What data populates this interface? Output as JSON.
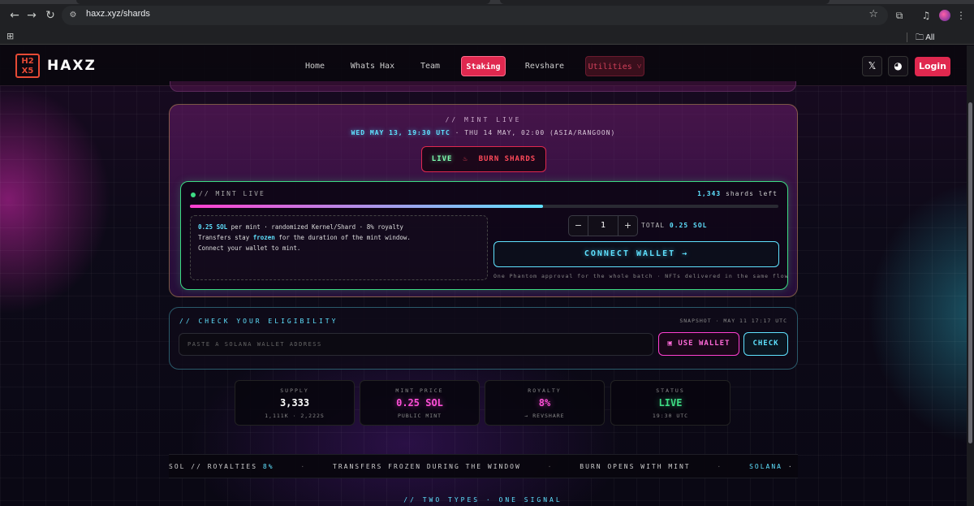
{
  "browser": {
    "url": "haxz.xyz/shards",
    "bookmarks_label": "All Bookmarks"
  },
  "header": {
    "logo_text": "HAXZ",
    "nav": [
      "Home",
      "Whats Hax",
      "Team",
      "Staking",
      "Revshare",
      "Utilities"
    ],
    "active_nav": "Staking",
    "login_label": "Login"
  },
  "mint": {
    "kicker": "// MINT LIVE",
    "start_time": "WED MAY 13, 19:30 UTC",
    "separator": "·",
    "end_time": "THU 14 MAY, 02:00 (ASIA/RANGOON)",
    "live_label": "LIVE",
    "burn_label": "BURN SHARDS",
    "status_label": "// MINT LIVE",
    "shards_left_count": "1,343",
    "shards_left_suffix": "shards left",
    "progress_fraction": 0.6,
    "info": {
      "price": "0.25 SOL",
      "line1_rest": "per mint · randomized Kernel/Shard · 8% royalty",
      "line2_pre": "Transfers stay",
      "line2_hl": "frozen",
      "line2_post": "for the duration of the mint window.",
      "line3": "Connect your wallet to mint."
    },
    "quantity": "1",
    "total_label": "TOTAL",
    "total_value": "0.25 SOL",
    "connect_label": "CONNECT WALLET →",
    "phantom_note": "One Phantom approval for the whole batch · NFTs delivered in the same flow"
  },
  "eligibility": {
    "title": "// CHECK YOUR ELIGIBILITY",
    "snapshot": "SNAPSHOT · MAY 11 17:17 UTC",
    "placeholder": "PASTE A SOLANA WALLET ADDRESS",
    "use_wallet_label": "USE WALLET",
    "check_label": "CHECK"
  },
  "stats": [
    {
      "label": "SUPPLY",
      "value": "3,333",
      "sub": "1,111K · 2,222S",
      "color": "#ffffff"
    },
    {
      "label": "MINT PRICE",
      "value": "0.25 SOL",
      "sub": "PUBLIC MINT",
      "color": "#ff4fd8"
    },
    {
      "label": "ROYALTY",
      "value": "8%",
      "sub": "→ REVSHARE",
      "color": "#ff4fd8"
    },
    {
      "label": "STATUS",
      "value": "LIVE",
      "sub": "19:30 UTC",
      "color": "#3ddc84"
    }
  ],
  "ticker": {
    "seg1_pre": "SOL // ROYALTIES",
    "seg1_hl": "8%",
    "seg2": "TRANSFERS FROZEN DURING THE WINDOW",
    "seg3": "BURN OPENS WITH MINT",
    "seg4_hl": "SOLANA",
    "seg4_post": "· NON-CUSTO",
    "dot": "·"
  },
  "footer_kicker": "// TWO TYPES · ONE SIGNAL",
  "colors": {
    "accent_red": "#e0284f",
    "cyan": "#5fe2ff",
    "magenta": "#ff3fd0",
    "green": "#3ddc84"
  }
}
